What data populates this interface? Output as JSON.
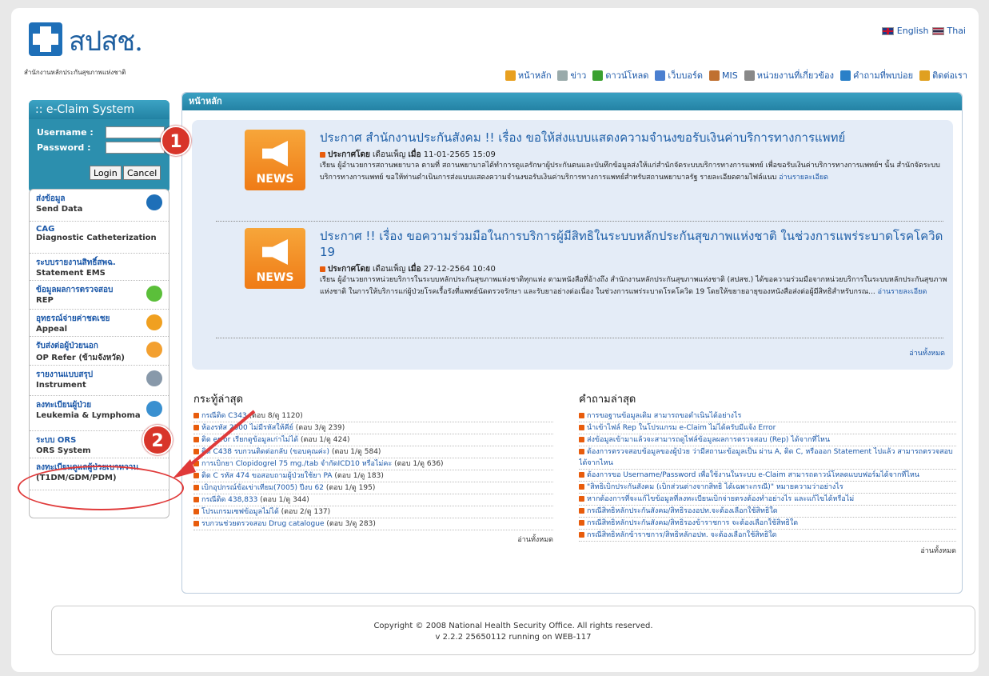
{
  "header": {
    "logo_text": "สปสช.",
    "logo_sub": "สำนักงานหลักประกันสุขภาพแห่งชาติ",
    "lang_en": "English",
    "lang_th": "Thai",
    "nav": [
      {
        "label": "หน้าหลัก",
        "icon": "home-icon",
        "color": "#e8a020"
      },
      {
        "label": "ข่าว",
        "icon": "page-icon",
        "color": "#9aa"
      },
      {
        "label": "ดาวน์โหลด",
        "icon": "download-icon",
        "color": "#3aa030"
      },
      {
        "label": "เว็บบอร์ด",
        "icon": "board-icon",
        "color": "#4a7fd0"
      },
      {
        "label": "MIS",
        "icon": "chart-icon",
        "color": "#c07030"
      },
      {
        "label": "หน่วยงานที่เกี่ยวข้อง",
        "icon": "link-icon",
        "color": "#888"
      },
      {
        "label": "คำถามที่พบบ่อย",
        "icon": "help-icon",
        "color": "#2a80c8"
      },
      {
        "label": "ติดต่อเรา",
        "icon": "mail-icon",
        "color": "#e0a020"
      }
    ]
  },
  "login": {
    "title": ":: e-Claim System",
    "username_label": "Username :",
    "password_label": "Password :",
    "login_button": "Login",
    "cancel_button": "Cancel"
  },
  "menu": [
    {
      "title": "ส่งข้อมูล",
      "sub": "Send Data",
      "icon": "send-data-icon"
    },
    {
      "title": "CAG",
      "sub": "Diagnostic Catheterization",
      "icon": ""
    },
    {
      "title": "ระบบรายงานสิทธิ์สพฉ.",
      "sub": "Statement EMS",
      "icon": ""
    },
    {
      "title": "ข้อมูลผลการตรวจสอบ",
      "sub": "REP",
      "icon": "check-icon"
    },
    {
      "title": "อุทธรณ์จ่ายค่าชดเชย",
      "sub": "Appeal",
      "icon": "appeal-icon"
    },
    {
      "title": "รับส่งต่อผู้ป่วยนอก",
      "sub": "OP Refer (ข้ามจังหวัด)",
      "icon": "refer-icon"
    },
    {
      "title": "รายงานแบบสรุป",
      "sub": "Instrument",
      "icon": "instrument-icon"
    },
    {
      "title": "ลงทะเบียนผู้ป่วย",
      "sub": "Leukemia & Lymphoma",
      "icon": "register-icon"
    },
    {
      "title": "ระบบ ORS",
      "sub": "ORS System",
      "icon": ""
    },
    {
      "title": "ลงทะเบียนดูแลผู้ป่วยเบาหวาน",
      "sub": "(T1DM/GDM/PDM)",
      "icon": ""
    }
  ],
  "main": {
    "bar_title": "หน้าหลัก",
    "news_label": "NEWS",
    "news": [
      {
        "title": "ประกาศ สำนักงานประกันสังคม !! เรื่อง ขอให้ส่งแบบแสดงความจำนงขอรับเงินค่าบริการทางการแพทย์",
        "posted_by_label": "ประกาศโดย",
        "posted_by": "เดือนเพ็ญ",
        "date_label": "เมื่อ",
        "date": "11-01-2565 15:09",
        "body": "เรียน ผู้อำนวยการสถานพยาบาล ตามที่ สถานพยาบาลได้ทำการดูแลรักษาผู้ประกันตนและบันทึกข้อมูลส่งให้แก่สำนักจัดระบบบริการทางการแพทย์ เพื่อขอรับเงินค่าบริการทางการแพทย์ฯ นั้น สำนักจัดระบบบริการทางการแพทย์ ขอให้ท่านดำเนินการส่งแบบแสดงความจำนงขอรับเงินค่าบริการทางการแพทย์สำหรับสถานพยาบาลรัฐ รายละเอียดตามไฟล์แนบ",
        "more": "อ่านรายละเอียด"
      },
      {
        "title": "ประกาศ !! เรื่อง ขอความร่วมมือในการบริการผู้มีสิทธิในระบบหลักประกันสุขภาพแห่งชาติ ในช่วงการแพร่ระบาดโรคโควิด 19",
        "posted_by_label": "ประกาศโดย",
        "posted_by": "เดือนเพ็ญ",
        "date_label": "เมื่อ",
        "date": "27-12-2564 10:40",
        "body": "เรียน ผู้อำนวยการหน่วยบริการในระบบหลักประกันสุขภาพแห่งชาติทุกแห่ง ตามหนังสือที่อ้างถึง สำนักงานหลักประกันสุขภาพแห่งชาติ (สปสช.) ได้ขอความร่วมมือจากหน่วยบริการในระบบหลักประกันสุขภาพแห่งชาติ ในการให้บริการแก่ผู้ป่วยโรคเรื้อรังที่แพทย์นัดตรวจรักษา และรับยาอย่างต่อเนื่อง ในช่วงการแพร่ระบาดโรคโควิด 19 โดยให้ขยายอายุของหนังสือส่งต่อผู้มีสิทธิสำหรับกรณ...",
        "more": "อ่านรายละเอียด"
      }
    ],
    "news_read_all": "อ่านทั้งหมด",
    "threads_title": "กระทู้ล่าสุด",
    "threads": [
      {
        "text": "กรณีติด C343",
        "count": "(ตอบ 8/ดู 1120)"
      },
      {
        "text": "ห้องรหัส 2500 ไม่มีรหัสให้คีย์",
        "count": "(ตอบ 3/ดู 239)"
      },
      {
        "text": "ติด error เรียกดูข้อมูลเก่าไม่ได้",
        "count": "(ตอบ 1/ดู 424)"
      },
      {
        "text": "ติด C438 รบกวนติดต่อกลับ (ขอบคุณค่ะ)",
        "count": "(ตอบ 1/ดู 584)"
      },
      {
        "text": "การเบิกยา Clopidogrel 75 mg./tab จำกัดICD10 หรือไม่คะ",
        "count": "(ตอบ 1/ดู 636)"
      },
      {
        "text": "ติด C รหัส 474 ขอสอบถามผู้ป่วยใช้ยา PA",
        "count": "(ตอบ 1/ดู 183)"
      },
      {
        "text": "เบิกอุปกรณ์ข้อเข่าเทียม(7005) ปีงบ 62",
        "count": "(ตอบ 1/ดู 195)"
      },
      {
        "text": "กรณีติด 438,833",
        "count": "(ตอบ 1/ดู 344)"
      },
      {
        "text": "โปรแกรมเซฟข้อมูลไม่ได้",
        "count": "(ตอบ 2/ดู 137)"
      },
      {
        "text": "รบกวนช่วยตรวจสอบ Drug catalogue",
        "count": "(ตอบ 3/ดู 283)"
      }
    ],
    "threads_read_all": "อ่านทั้งหมด",
    "faq_title": "คำถามล่าสุด",
    "faq": [
      "การขอฐานข้อมูลเดิม สามารถขอดำเนินได้อย่างไร",
      "นำเข้าไฟล์ Rep ในโปรแกรม e-Claim ไม่ได้ครับมีแจ้ง Error",
      "ส่งข้อมูลเข้ามาแล้วจะสามารถดูไฟล์ข้อมูลผลการตรวจสอบ (Rep) ได้จากที่ไหน",
      "ต้องการตรวจสอบข้อมูลของผู้ป่วย ว่ามีสถานะข้อมูลเป็น ผ่าน A, ติด C, หรือออก Statement ไปแล้ว สามารถตรวจสอบได้จากไหน",
      "ต้องการขอ Username/Password เพื่อใช้งานในระบบ e-Claim สามารถดาวน์โหลดแบบฟอร์มได้จากที่ไหน",
      "\"สิทธิเบิกประกันสังคม (เบิกส่วนต่างจากสิทธิ ได้เฉพาะกรณี)\" หมายความว่าอย่างไร",
      "หากต้องการที่จะแก้ไขข้อมูลที่ลงทะเบียนเบิกจ่ายตรงต้องทำอย่างไร และแก้ไขได้หรือไม่",
      "กรณีสิทธิหลักประกันสังคม/สิทธิรองอปท.จะต้องเลือกใช้สิทธิใด",
      "กรณีสิทธิหลักประกันสังคม/สิทธิรองข้าราชการ จะต้องเลือกใช้สิทธิใด",
      "กรณีสิทธิหลักข้าราชการ/สิทธิหลักอปท. จะต้องเลือกใช้สิทธิใด"
    ],
    "faq_read_all": "อ่านทั้งหมด"
  },
  "footer": {
    "copyright": "Copyright © 2008 National Health Security Office. All rights reserved.",
    "version": "v 2.2.2 25650112 running on WEB-117"
  },
  "annotations": {
    "badge1": "1",
    "badge2": "2",
    "accent": "#d8352a"
  }
}
